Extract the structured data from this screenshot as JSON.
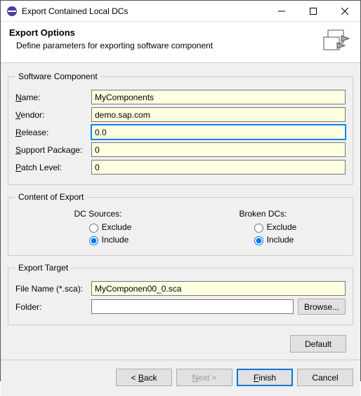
{
  "window": {
    "title": "Export Contained Local DCs"
  },
  "header": {
    "title": "Export Options",
    "subtitle": "Define parameters for exporting software component"
  },
  "groups": {
    "software": {
      "legend": "Software Component",
      "name_label_pre": "N",
      "name_label_post": "ame:",
      "name_value": "MyComponents",
      "vendor_label_pre": "V",
      "vendor_label_post": "endor:",
      "vendor_value": "demo.sap.com",
      "release_label_pre": "R",
      "release_label_post": "elease:",
      "release_value": "0.0",
      "sp_label_pre": "S",
      "sp_label_post": "upport Package:",
      "sp_value": "0",
      "patch_label_pre": "P",
      "patch_label_post": "atch Level:",
      "patch_value": "0"
    },
    "content": {
      "legend": "Content of Export",
      "dc_sources_label": "DC Sources:",
      "broken_dcs_label": "Broken DCs:",
      "exclude_label": "Exclude",
      "include_label": "Include",
      "dc_sources_selected": "include",
      "broken_selected": "include"
    },
    "target": {
      "legend": "Export Target",
      "filename_label": "File Name (*.sca):",
      "filename_value": "MyComponen00_0.sca",
      "folder_label": "Folder:",
      "folder_value": "",
      "browse_label": "Browse..."
    }
  },
  "buttons": {
    "default": "Default",
    "back": "< Back",
    "next": "Next >",
    "finish": "Finish",
    "cancel": "Cancel"
  }
}
